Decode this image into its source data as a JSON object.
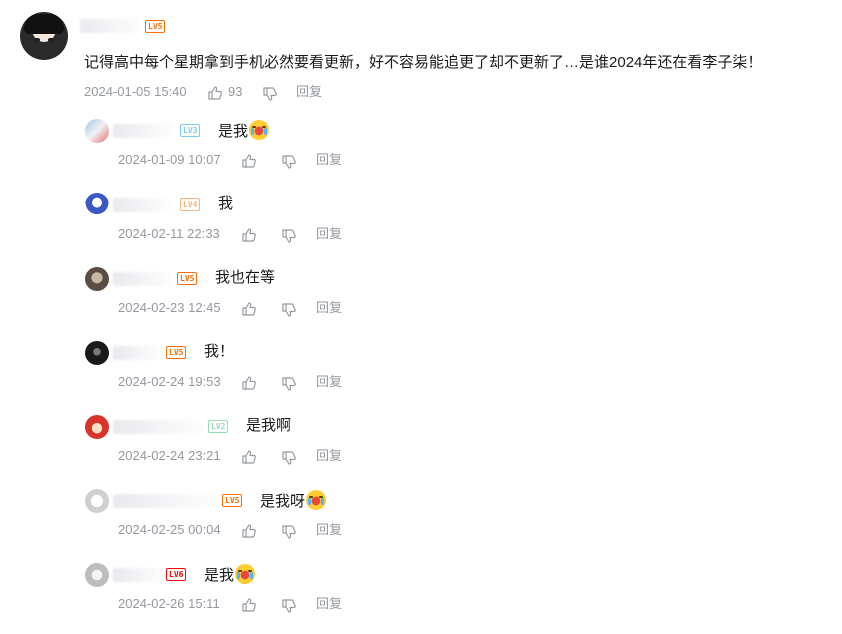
{
  "main": {
    "level": "LV5",
    "text": "记得高中每个星期拿到手机必然要看更新，好不容易能追更了却不更新了…是谁2024年还在看李子柒！",
    "time": "2024-01-05 15:40",
    "likes": "93",
    "reply_label": "回复"
  },
  "reply_label": "回复",
  "colors": {
    "lv5": "#ff6c00",
    "lv4": "#ffb37c",
    "lv3": "#7bcdef",
    "lv2": "#95ddb2",
    "lv6": "#ff0000"
  },
  "replies": [
    {
      "level": "LV3",
      "text": "是我",
      "emoji": "crying-emoji",
      "time": "2024-01-09 10:07"
    },
    {
      "level": "LV4",
      "text": "我",
      "time": "2024-02-11 22:33"
    },
    {
      "level": "LV5",
      "text": "我也在等",
      "time": "2024-02-23 12:45"
    },
    {
      "level": "LV5",
      "text": "我！",
      "time": "2024-02-24 19:53"
    },
    {
      "level": "LV2",
      "text": "是我啊",
      "time": "2024-02-24 23:21"
    },
    {
      "level": "LV5",
      "text": "是我呀",
      "emoji": "crying-emoji",
      "time": "2024-02-25 00:04"
    },
    {
      "level": "LV6",
      "text": "是我",
      "emoji": "crying-emoji",
      "time": "2024-02-26 15:11"
    }
  ]
}
